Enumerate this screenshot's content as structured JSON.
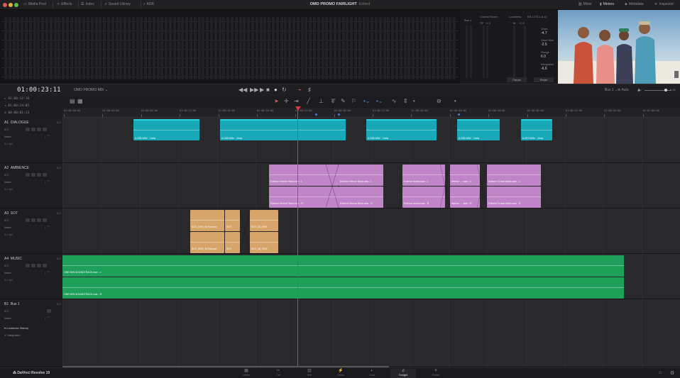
{
  "topbar": {
    "left_items": [
      {
        "icon": "media-pool-icon",
        "label": "Media Pool"
      },
      {
        "icon": "effects-icon",
        "label": "Effects"
      },
      {
        "icon": "index-icon",
        "label": "Index"
      },
      {
        "icon": "sound-library-icon",
        "label": "Sound Library"
      },
      {
        "icon": "adr-icon",
        "label": "ADR"
      }
    ],
    "title": "OMO PROMO FAIRLIGHT",
    "title_status": "Edited",
    "right_items": [
      {
        "icon": "mixer-icon",
        "label": "Mixer"
      },
      {
        "icon": "meters-icon",
        "label": "Meters"
      },
      {
        "icon": "metadata-icon",
        "label": "Metadata"
      },
      {
        "icon": "inspector-icon",
        "label": "Inspector"
      }
    ]
  },
  "right_panel": {
    "bus_label": "Bus 1",
    "control_room_label": "Control Room",
    "tp_label": "TP",
    "tp_value": "-0.3",
    "loudness_label": "Loudness",
    "loudness_standard": "BS.1770-1 (LU)",
    "m_label": "M",
    "m_value": "+1.0",
    "stats": [
      {
        "label": "Short",
        "value": "-4.7"
      },
      {
        "label": "Short Max",
        "value": "-2.5"
      },
      {
        "label": "Range",
        "value": "6.0"
      },
      {
        "label": "Integrated",
        "value": "-6.6"
      }
    ],
    "pause_label": "Pause",
    "reset_label": "Reset"
  },
  "transport": {
    "timecode": "01:00:23:11",
    "timeline_name": "OMO PROMO MIX",
    "bus_select": "Bus 1",
    "auto_label": "Auto",
    "db_value": "0.00"
  },
  "left_info": {
    "tc_in": "01:00:12:16",
    "tc_out": "01:00:14:05",
    "tc_dur": "00:00:01:13"
  },
  "ruler": {
    "labels": [
      "01:00:00:00",
      "01:00:04:00",
      "01:00:08:00",
      "01:00:12:00",
      "01:00:16:00",
      "01:00:20:00",
      "01:00:24:00",
      "01:00:28:00",
      "01:00:32:00",
      "01:00:36:00",
      "01:00:40:00",
      "01:00:44:00",
      "01:00:48:00",
      "01:00:52:00",
      "01:00:56:00",
      "01:01:00:00"
    ]
  },
  "tracks": [
    {
      "id": "A1",
      "name": "DIALOGUE",
      "channels": "2.0",
      "volume": "0.0",
      "input": "None",
      "fx": "5.0 Ipc",
      "clips": [
        {
          "label": "A-008.WAV - Chris"
        },
        {
          "label": "A-008.WAV - Chris"
        },
        {
          "label": "A-008.WAV - Chris"
        },
        {
          "label": "A-008.WAV - Chris"
        },
        {
          "label": "A-007.WAV - Chris"
        }
      ]
    },
    {
      "id": "A2",
      "name": "AMBIENCE",
      "channels": "2.0",
      "volume": "0.0",
      "input": "None",
      "fx": "5.0 Ipc",
      "clips": [
        {
          "top": "Exterior Vernon Wind.wav - L",
          "bottom": "Exterior Vernon Wind.wav - R"
        },
        {
          "top": "Exterior Vernon Birds.wav - L",
          "bottom": "Exterior Vernon Birds.wav - R"
        },
        {
          "top": "Exterior dunes.wav - L",
          "bottom": "Exterior dunes.wav - R"
        },
        {
          "top": "Interior ... .wav - L",
          "bottom": "Interior ... .wav - R"
        },
        {
          "top": "Exterior Crowd Walla.wav - L",
          "bottom": "Exterior Crowd Walla.wav - R"
        }
      ]
    },
    {
      "id": "A3",
      "name": "SOT",
      "channels": "2.0",
      "volume": "0.0",
      "input": "None",
      "fx": "5.0 Ipc",
      "clips": [
        {
          "top": "SOT_0001_B-Roll.wav",
          "bottom": "SOT_0001_B-Roll.wav"
        },
        {
          "top": "SOT",
          "bottom": "SOT"
        },
        {
          "top": "SOT_08_0001",
          "bottom": "SOT_08_0001"
        }
      ]
    },
    {
      "id": "A4",
      "name": "MUSIC",
      "channels": "2.0",
      "volume": "0.0",
      "input": "None",
      "fx": "5.0 Ipc",
      "clips": [
        {
          "top": "ONE MIN SOUNDTRACK.wav - L",
          "bottom": "ONE MIN SOUNDTRACK.wav - R"
        }
      ]
    },
    {
      "id": "B1",
      "name": "Bus 1",
      "channels": "2.0",
      "volume": "0.0",
      "input": "None",
      "lanes": [
        {
          "label": "Loudness History"
        },
        {
          "label": "Integrated"
        }
      ]
    }
  ],
  "bottombar": {
    "app": "DaVinci Resolve 19",
    "pages": [
      {
        "icon": "media-page-icon",
        "label": "Media"
      },
      {
        "icon": "cut-page-icon",
        "label": "Cut"
      },
      {
        "icon": "edit-page-icon",
        "label": "Edit"
      },
      {
        "icon": "fusion-page-icon",
        "label": "Fusion"
      },
      {
        "icon": "color-page-icon",
        "label": "Color"
      },
      {
        "icon": "fairlight-page-icon",
        "label": "Fairlight"
      },
      {
        "icon": "deliver-page-icon",
        "label": "Deliver"
      }
    ],
    "active_page": "Fairlight"
  },
  "colors": {
    "dialogue": "#18a8b8",
    "ambience": "#c084c8",
    "sot": "#d7a56a",
    "music": "#1ea05a",
    "playhead": "#e03838"
  }
}
